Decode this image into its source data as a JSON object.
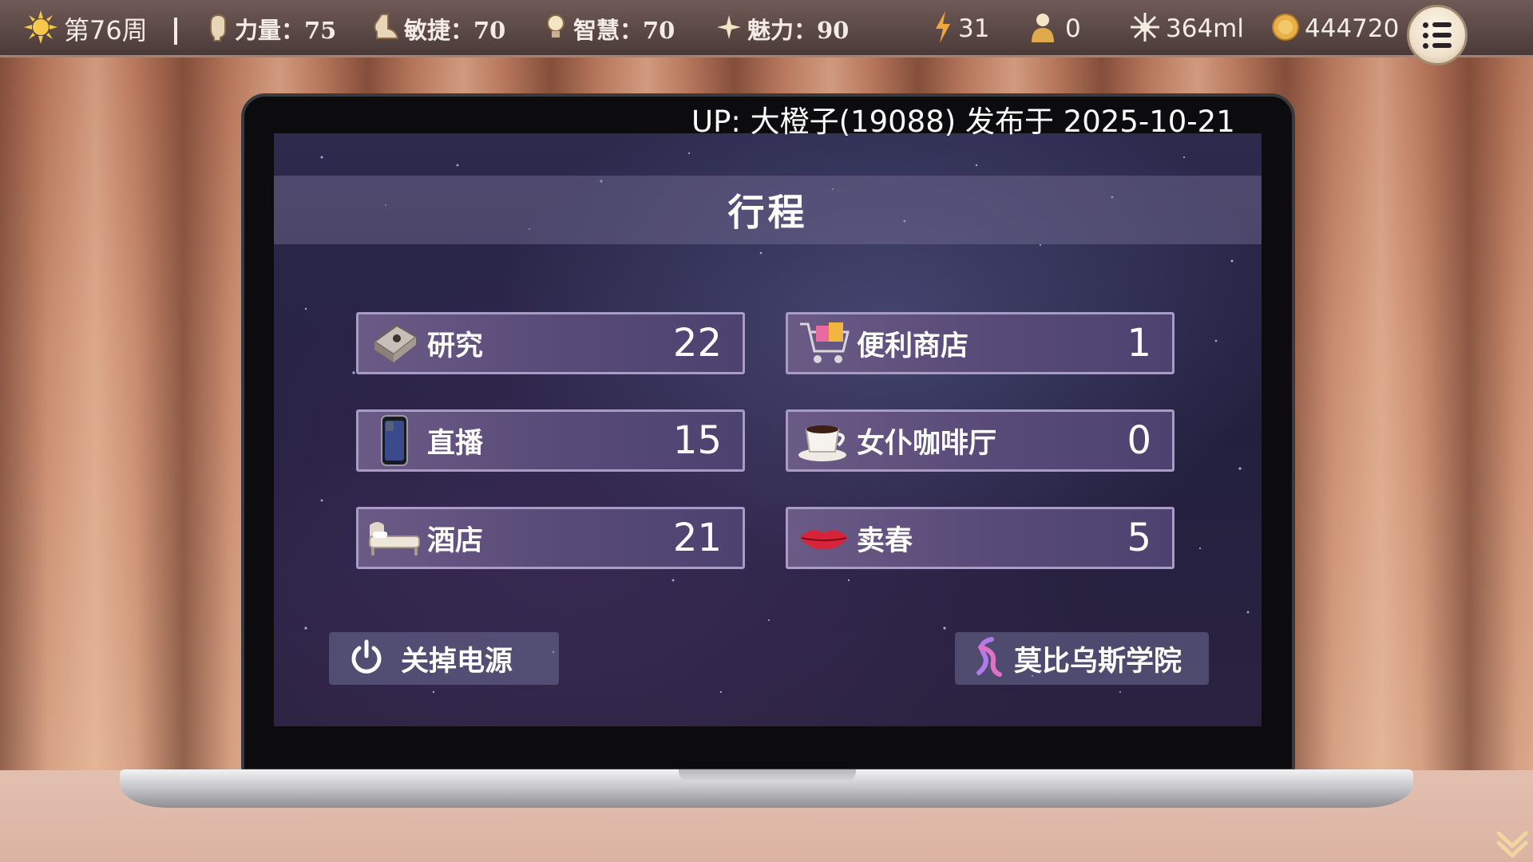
{
  "hud": {
    "week": "第76周",
    "strength_label": "力量：75",
    "agility_label": "敏捷：70",
    "wisdom_label": "智慧：70",
    "charm_label": "魅力：90",
    "energy": "31",
    "followers": "0",
    "milk": "364ml",
    "gold": "444720",
    "icons": [
      "sun-icon",
      "fist-icon",
      "boot-icon",
      "bulb-icon",
      "sparkle-icon",
      "lightning-icon",
      "person-icon",
      "burst-icon",
      "coin-icon",
      "menu-icon"
    ]
  },
  "uploader_note": "UP: 大橙子(19088) 发布于 2025-10-21",
  "schedule": {
    "title": "行程",
    "items": [
      {
        "label": "研究",
        "count": "22",
        "icon": "research-icon"
      },
      {
        "label": "便利商店",
        "count": "1",
        "icon": "shopping-cart-icon"
      },
      {
        "label": "直播",
        "count": "15",
        "icon": "phone-icon"
      },
      {
        "label": "女仆咖啡厅",
        "count": "0",
        "icon": "coffee-cup-icon"
      },
      {
        "label": "酒店",
        "count": "21",
        "icon": "bed-icon"
      },
      {
        "label": "卖春",
        "count": "5",
        "icon": "lips-icon"
      }
    ],
    "power_off_label": "关掉电源",
    "academy_label": "莫比乌斯学院"
  },
  "colors": {
    "hud_bg": "#4a3b39",
    "button_bg": "#574a78",
    "button_border": "#a89cc4",
    "screen_bg": "#23203f"
  }
}
